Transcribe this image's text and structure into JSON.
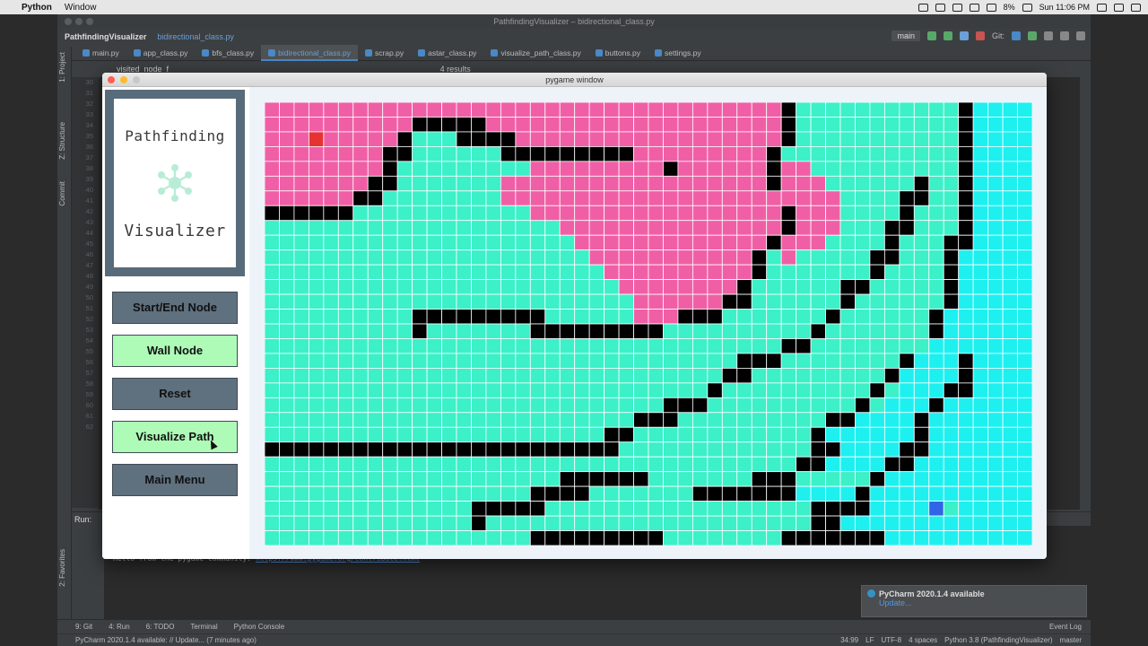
{
  "menubar": {
    "app": "Python",
    "menu": "Window",
    "battery": "8%",
    "clock": "Sun 11:06 PM"
  },
  "ide": {
    "window_title": "PathfindingVisualizer – bidirectional_class.py",
    "project": "PathfindingVisualizer",
    "current_file": "bidirectional_class.py",
    "branch": "main",
    "git_label": "Git:",
    "tabs": [
      "main.py",
      "app_class.py",
      "bfs_class.py",
      "bidirectional_class.py",
      "scrap.py",
      "astar_class.py",
      "visualize_path_class.py",
      "buttons.py",
      "settings.py"
    ],
    "find_text": "visited_node_f",
    "find_results": "4 results",
    "line_numbers": [
      "30",
      "31",
      "32",
      "33",
      "34",
      "35",
      "36",
      "37",
      "38",
      "39",
      "40",
      "41",
      "42",
      "43",
      "44",
      "45",
      "46",
      "47",
      "48",
      "49",
      "50",
      "51",
      "52",
      "53",
      "54",
      "55",
      "56",
      "57",
      "58",
      "59",
      "60",
      "61",
      "62"
    ],
    "left_strip": [
      "1: Project",
      "Z: Structure",
      "Commit",
      "2: Favorites"
    ],
    "run_label": "Run:",
    "console_text": "Hello from the pygame community.",
    "console_link": "https://www.pygame.org/contribute.html",
    "notification": {
      "title": "PyCharm 2020.1.4 available",
      "action": "Update..."
    },
    "bottom_tabs": [
      "9: Git",
      "4: Run",
      "6: TODO",
      "Terminal",
      "Python Console"
    ],
    "event_log": "Event Log",
    "status_left": "PyCharm 2020.1.4 available: // Update... (7 minutes ago)",
    "status_right": [
      "34:99",
      "LF",
      "UTF-8",
      "4 spaces",
      "Python 3.8 (PathfindingVisualizer)",
      "master"
    ]
  },
  "pygame": {
    "window_title": "pygame window",
    "logo_line1": "Pathfinding",
    "logo_line2": "Visualizer",
    "buttons": [
      "Start/End Node",
      "Wall Node",
      "Reset",
      "Visualize Path",
      "Main Menu"
    ],
    "colors": {
      "empty": "#ffffff",
      "wall": "#000000",
      "start_visited": "#f05fa6",
      "end_visited": "#3cf0c8",
      "frontier": "#1ef0f0",
      "start_node": "#e63232",
      "end_node": "#3264e6",
      "grid_line": "#ffffff"
    },
    "grid": {
      "cols": 52,
      "rows": 30,
      "legend": "W=wall P=visited-from-start G=visited-from-end C=frontier S=start E=end",
      "cells": [
        "PPPPPPPPPPPPPPPPPPPPPPPPPPPPPPPPPPPWGGGGGGGGGGGWCCCC",
        "PPPPPPPPPPWWWWWPPPPPPPPPPPPPPPPPPPPWGGGGGGGGGGGWCCCC",
        "PPPSPPPPPWGGGWWWWPPPPPPPPPPPPPPPPPPWGGGGGGGGGGGWCCCC",
        "PPPPPPPPWWGGGGGGWWWWWWWWWPPPPPPPPPWGGGGGGGGGGGGWCCCC",
        "PPPPPPPPWGGGGGGGGGPPPPPPPPPWPPPPPPWPPGGGGGGGGGGWCCCC",
        "PPPPPPPWWGGGGGGGPPPPPPPPPPPPPPPPPPWPPPGGGGGGWGGWCCCC",
        "PPPPPPWWGGGGGGGGPPPPPPPPPPPPPPPPPPPPPPPGGGGWWGGWCCCC",
        "WWWWWWGGGGGGGGGGGGPPPPPPPPPPPPPPPPPWPPPGGGGWGGGWCCCC",
        "GGGGGGGGGGGGGGGGGGGGPPPPPPPPPPPPPPPWPPPGGGWWGGGWCCCC",
        "GGGGGGGGGGGGGGGGGGGGGPPPPPPPPPPPPPWPPPGGGGWGGGWWCCCC",
        "GGGGGGGGGGGGGGGGGGGGGGPPPPPPPPPPPWGPGGGGGWWGGGWCCCCC",
        "GGGGGGGGGGGGGGGGGGGGGGGPPPPPPPPPPWGGGGGGGWGGGGWCCCCC",
        "GGGGGGGGGGGGGGGGGGGGGGGGPPPPPPPPWGGGGGGWWGGGGGWCCCCC",
        "GGGGGGGGGGGGGGGGGGGGGGGGGPPPPPPWWGGGGGGWGGGGGGWCCCCC",
        "GGGGGGGGGGWWWWWWWWWGGGGGGPPPWWWGGGGGGGWGGGGGGWCCCCCC",
        "GGGGGGGGGGWGGGGGGGWWWWWWWWWGGGGGGGGGGWGGGGGGGWCCCCCC",
        "GGGGGGGGGGGGGGGGGGGGGGGGGGGGGGGGGGGWWGGGGGGGGCCCCCCC",
        "GGGGGGGGGGGGGGGGGGGGGGGGGGGGGGGGWWWGGGGGGGGWCCCWCCCC",
        "GGGGGGGGGGGGGGGGGGGGGGGGGGGGGGGWWGGGGGGGGGWCCCCWCCCC",
        "GGGGGGGGGGGGGGGGGGGGGGGGGGGGGGWGGGGGGGGGGWGCCCWWCCCC",
        "GGGGGGGGGGGGGGGGGGGGGGGGGGGWWWGGGGGGGGGGWGCCCWCCCCCC",
        "GGGGGGGGGGGGGGGGGGGGGGGGGWWWGGGGGGGGGGWWCCCCWCCCCCCC",
        "GGGGGGGGGGGGGGGGGGGGGGGWWGGGGGGGGGGGGWCCCCCCWCCCCCCC",
        "WWWWWWWWWWWWWWWWWWWWWWWWGGGGGGGGGGGGGWWCCCCWWCCCCCCC",
        "GGGGGGGGGGGGGGGGGGGGGGGGGGGGGGGGGGGGWWCCCCWWCCCCCCCC",
        "GGGGGGGGGGGGGGGGGGGGWWWWWWGGGGGGGWWWGGGGGWCCCCCCCCCC",
        "GGGGGGGGGGGGGGGGGGWWWWGGGGGGGWWWWWWWCCCCWCCCCCCCCCCC",
        "GGGGGGGGGGGGGGWWWWWGGGGGGGGGGGGGGGGGGWWWWCCCCEGCCCCC",
        "GGGGGGGGGGGGGGWGGGGGGGGGGGGGGGGGGGGGGWWCCCCCCCCCCCCC",
        "GGGGGGGGGGGGGGGGGGWWWWWWWWWGGGGGGGGWWWWWWWCCCCCCCCCC"
      ]
    }
  }
}
